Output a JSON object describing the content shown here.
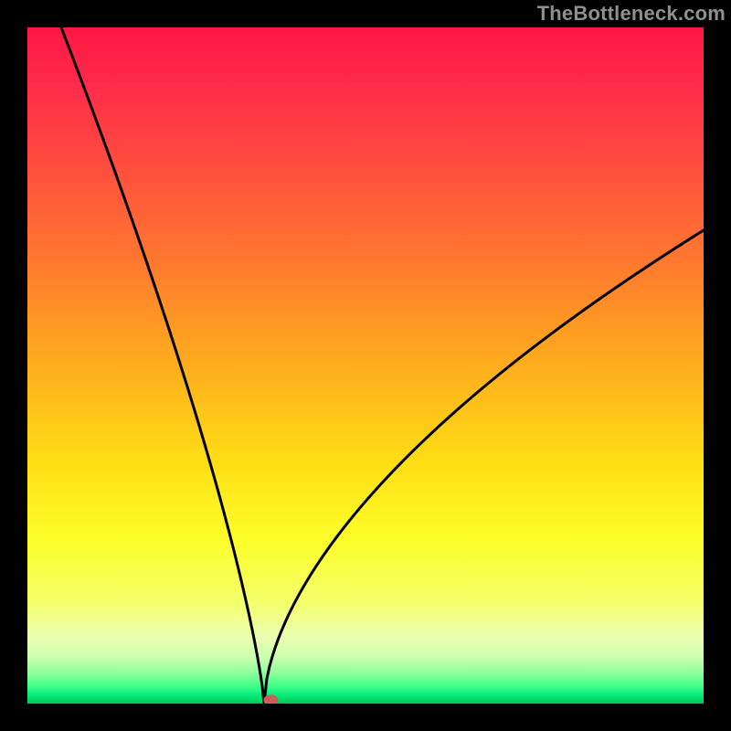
{
  "watermark": "TheBottleneck.com",
  "chart_data": {
    "type": "line",
    "title": "",
    "xlabel": "",
    "ylabel": "",
    "xlim": [
      0,
      100
    ],
    "ylim": [
      0,
      100
    ],
    "curve": {
      "minimum_x": 35,
      "left_start": {
        "x": 5,
        "y": 100
      },
      "right_end": {
        "x": 100,
        "y": 70
      },
      "description": "V-shaped cusp curve with vertex near x≈35 at y=0; rises steeply to left boundary (~x=5,y=100) and more gradually to the right reaching y≈70 at x=100"
    },
    "marker": {
      "x": 36,
      "y": 0.5,
      "color": "#cc5e5a"
    },
    "background_gradient": {
      "stops": [
        {
          "offset": 0.0,
          "color": "#ff1744"
        },
        {
          "offset": 0.08,
          "color": "#ff2a4a"
        },
        {
          "offset": 0.2,
          "color": "#ff4c3f"
        },
        {
          "offset": 0.35,
          "color": "#ff7a2e"
        },
        {
          "offset": 0.5,
          "color": "#ffad1d"
        },
        {
          "offset": 0.65,
          "color": "#ffe015"
        },
        {
          "offset": 0.76,
          "color": "#fcff2b"
        },
        {
          "offset": 0.85,
          "color": "#f4ff6a"
        },
        {
          "offset": 0.9,
          "color": "#ecffb0"
        },
        {
          "offset": 0.93,
          "color": "#ceffaf"
        },
        {
          "offset": 0.955,
          "color": "#8fff9a"
        },
        {
          "offset": 0.975,
          "color": "#3cff8a"
        },
        {
          "offset": 0.99,
          "color": "#00e676"
        },
        {
          "offset": 1.0,
          "color": "#00c853"
        }
      ]
    }
  }
}
